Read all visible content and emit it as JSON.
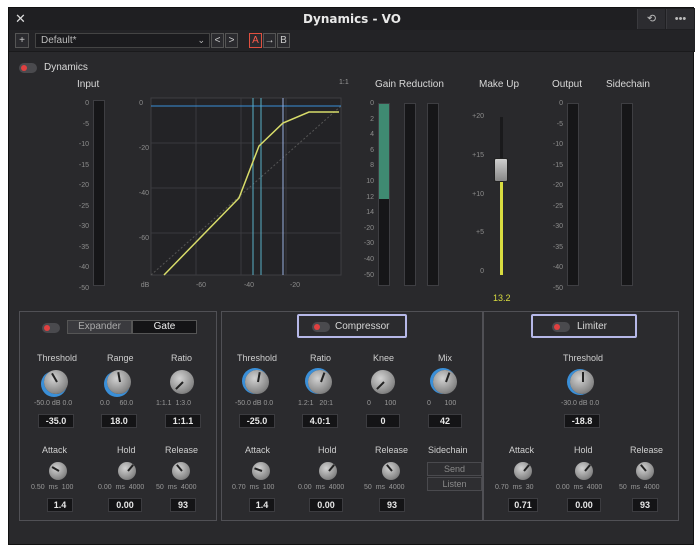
{
  "window": {
    "title": "Dynamics - VO"
  },
  "toolbar": {
    "add": "+",
    "preset": "Default*",
    "prev": "<",
    "next": ">",
    "a": "A",
    "copy": "→",
    "b": "B"
  },
  "dynamics": {
    "label": "Dynamics"
  },
  "graph": {
    "ratio_label": "1:1",
    "y_ticks": [
      "0",
      "-20",
      "-40",
      "-60"
    ],
    "x_ticks": [
      "dB",
      "-60",
      "-40",
      "-20"
    ]
  },
  "meters": {
    "input": "Input",
    "gain_reduction": "Gain Reduction",
    "make_up": "Make Up",
    "output": "Output",
    "sidechain": "Sidechain",
    "db_scale": [
      "0",
      "-5",
      "-10",
      "-15",
      "-20",
      "-25",
      "-30",
      "-35",
      "-40",
      "-50"
    ],
    "gr_scale": [
      "0",
      "2",
      "4",
      "6",
      "8",
      "10",
      "12",
      "14",
      "-20",
      "-30",
      "-40",
      "-50"
    ],
    "makeup_scale": [
      "+20",
      "+15",
      "+10",
      "+5",
      "0"
    ],
    "makeup_value": "13.2"
  },
  "gate": {
    "tab_expander": "Expander",
    "tab_gate": "Gate",
    "threshold": {
      "label": "Threshold",
      "min": "-50.0",
      "unit": "dB",
      "max": "0.0",
      "value": "-35.0"
    },
    "range": {
      "label": "Range",
      "min": "0.0",
      "max": "60.0",
      "value": "18.0"
    },
    "ratio": {
      "label": "Ratio",
      "min": "1:1.1",
      "max": "1:3.0",
      "value": "1:1.1"
    },
    "attack": {
      "label": "Attack",
      "min": "0.50",
      "unit": "ms",
      "max": "100",
      "value": "1.4"
    },
    "hold": {
      "label": "Hold",
      "min": "0.00",
      "unit": "ms",
      "max": "4000",
      "value": "0.00"
    },
    "release": {
      "label": "Release",
      "min": "50",
      "unit": "ms",
      "max": "4000",
      "value": "93"
    }
  },
  "compressor": {
    "label": "Compressor",
    "threshold": {
      "label": "Threshold",
      "min": "-50.0",
      "unit": "dB",
      "max": "0.0",
      "value": "-25.0"
    },
    "ratio": {
      "label": "Ratio",
      "min": "1.2:1",
      "max": "20:1",
      "value": "4.0:1"
    },
    "knee": {
      "label": "Knee",
      "min": "0",
      "max": "100",
      "value": "0"
    },
    "mix": {
      "label": "Mix",
      "min": "0",
      "max": "100",
      "value": "42"
    },
    "attack": {
      "label": "Attack",
      "min": "0.70",
      "unit": "ms",
      "max": "100",
      "value": "1.4"
    },
    "hold": {
      "label": "Hold",
      "min": "0.00",
      "unit": "ms",
      "max": "4000",
      "value": "0.00"
    },
    "release": {
      "label": "Release",
      "min": "50",
      "unit": "ms",
      "max": "4000",
      "value": "93"
    },
    "sidechain": {
      "label": "Sidechain",
      "send": "Send",
      "listen": "Listen"
    }
  },
  "limiter": {
    "label": "Limiter",
    "threshold": {
      "label": "Threshold",
      "min": "-30.0",
      "unit": "dB",
      "max": "0.0",
      "value": "-18.8"
    },
    "attack": {
      "label": "Attack",
      "min": "0.70",
      "unit": "ms",
      "max": "30",
      "value": "0.71"
    },
    "hold": {
      "label": "Hold",
      "min": "0.00",
      "unit": "ms",
      "max": "4000",
      "value": "0.00"
    },
    "release": {
      "label": "Release",
      "min": "50",
      "unit": "ms",
      "max": "4000",
      "value": "93"
    }
  },
  "colors": {
    "curve": "#d8dc6a",
    "threshold_line": "#5ab0c8",
    "knob_ring": "#3a8fd8",
    "gr_fill": "#3f8a72",
    "toggle_red": "#e04040",
    "highlight": "#b6b8e8"
  }
}
